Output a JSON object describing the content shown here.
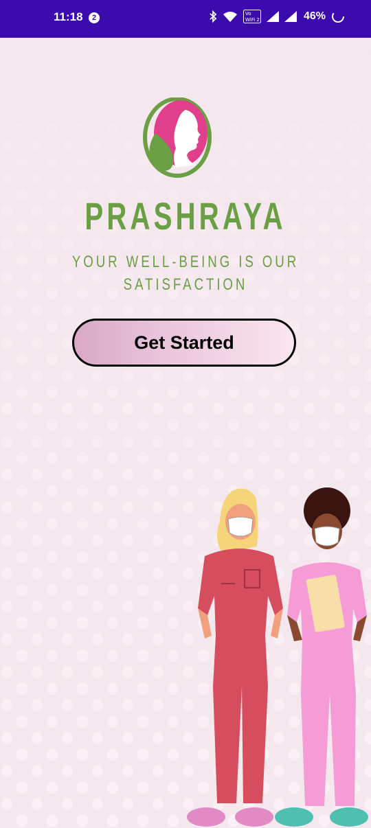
{
  "status_bar": {
    "time": "11:18",
    "notification_count": "2",
    "battery_percent": "46%",
    "background_color": "#3c0bae"
  },
  "app": {
    "name": "PRASHRAYA",
    "tagline_line1": "YOUR WELL-BEING IS OUR",
    "tagline_line2": "SATISFACTION",
    "get_started_label": "Get Started",
    "brand_color": "#6a9f43",
    "accent_color": "#e0408b"
  }
}
